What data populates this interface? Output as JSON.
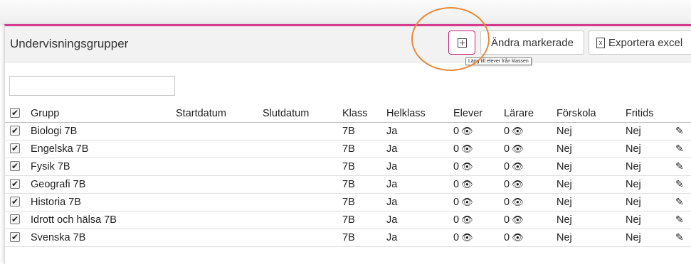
{
  "header": {
    "title": "Undervisningsgrupper",
    "add_button_glyph": "⊞",
    "edit_button_label": "Ändra markerade",
    "export_button_label": "Exportera excel",
    "export_icon": "excel-icon",
    "tooltip": "Lägg till elever från klassen"
  },
  "search": {
    "value": "",
    "placeholder": ""
  },
  "table": {
    "columns": [
      "Grupp",
      "Startdatum",
      "Slutdatum",
      "Klass",
      "Helklass",
      "Elever",
      "Lärare",
      "Förskola",
      "Fritids"
    ],
    "rows": [
      {
        "checked": true,
        "group": "Biologi 7B",
        "start": "",
        "end": "",
        "class": "7B",
        "whole_class": "Ja",
        "students": "0",
        "teachers": "0",
        "preschool": "Nej",
        "leisure": "Nej"
      },
      {
        "checked": true,
        "group": "Engelska 7B",
        "start": "",
        "end": "",
        "class": "7B",
        "whole_class": "Ja",
        "students": "0",
        "teachers": "0",
        "preschool": "Nej",
        "leisure": "Nej"
      },
      {
        "checked": true,
        "group": "Fysik 7B",
        "start": "",
        "end": "",
        "class": "7B",
        "whole_class": "Ja",
        "students": "0",
        "teachers": "0",
        "preschool": "Nej",
        "leisure": "Nej"
      },
      {
        "checked": true,
        "group": "Geografi 7B",
        "start": "",
        "end": "",
        "class": "7B",
        "whole_class": "Ja",
        "students": "0",
        "teachers": "0",
        "preschool": "Nej",
        "leisure": "Nej"
      },
      {
        "checked": true,
        "group": "Historia 7B",
        "start": "",
        "end": "",
        "class": "7B",
        "whole_class": "Ja",
        "students": "0",
        "teachers": "0",
        "preschool": "Nej",
        "leisure": "Nej"
      },
      {
        "checked": true,
        "group": "Idrott och hälsa 7B",
        "start": "",
        "end": "",
        "class": "7B",
        "whole_class": "Ja",
        "students": "0",
        "teachers": "0",
        "preschool": "Nej",
        "leisure": "Nej"
      },
      {
        "checked": true,
        "group": "Svenska 7B",
        "start": "",
        "end": "",
        "class": "7B",
        "whole_class": "Ja",
        "students": "0",
        "teachers": "0",
        "preschool": "Nej",
        "leisure": "Nej"
      }
    ]
  },
  "glyphs": {
    "check": "✔",
    "eye": "👁",
    "edit": "✎"
  },
  "colors": {
    "accent": "#d63a8e",
    "highlight": "#e8893c"
  }
}
